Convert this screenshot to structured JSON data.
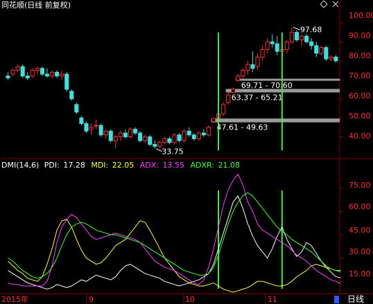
{
  "title": "同花顺(日线 前复权)",
  "top_right_icons": [
    "diamond-icon",
    "close-icon"
  ],
  "price_axis": {
    "ticks": [
      "100.00",
      "90.00",
      "80.00",
      "70.00",
      "60.00",
      "50.00",
      "40.00"
    ]
  },
  "dmi_header": {
    "name": "DMI(14,6)",
    "items": [
      {
        "label": "PDI:",
        "value": "17.28",
        "color": "#ffffff"
      },
      {
        "label": "MDI:",
        "value": "22.05",
        "color": "#ffff44"
      },
      {
        "label": "ADX:",
        "value": "13.55",
        "color": "#ff44ff"
      },
      {
        "label": "ADXR:",
        "value": "21.08",
        "color": "#44ff44"
      }
    ]
  },
  "dmi_axis": {
    "ticks": [
      "75.00",
      "60.00",
      "45.00",
      "30.00",
      "15.00"
    ]
  },
  "x_axis": {
    "labels": [
      "2015年",
      "9",
      "10",
      "11"
    ],
    "right_label": "日线"
  },
  "annotations": {
    "high": "97.68",
    "low": "33.75",
    "ranges": [
      "69.71 - 70.60",
      "63.37 - 65.21",
      "47.61 - 49.63"
    ]
  },
  "colors": {
    "up": "#ff3333",
    "down": "#44dddd",
    "grid_red": "#8a0000",
    "pdi": "#ffffff",
    "mdi": "#ffff44",
    "adx": "#ff44ff",
    "adxr": "#44ff44",
    "marker": "#44ee44",
    "gap_band": "#9a9a9a",
    "axis_text": "#ff3333"
  },
  "chart_data": [
    {
      "type": "candlestick",
      "title": "同花顺(日线 前复权)",
      "ylim": [
        30,
        104
      ],
      "candles": [
        {
          "o": 72,
          "h": 74,
          "l": 70,
          "c": 71
        },
        {
          "o": 73,
          "h": 76,
          "l": 72,
          "c": 75
        },
        {
          "o": 75,
          "h": 78,
          "l": 74,
          "c": 77
        },
        {
          "o": 77,
          "h": 78,
          "l": 71,
          "c": 72
        },
        {
          "o": 72,
          "h": 74,
          "l": 70,
          "c": 71
        },
        {
          "o": 72,
          "h": 76,
          "l": 71,
          "c": 75
        },
        {
          "o": 75,
          "h": 77,
          "l": 73,
          "c": 76
        },
        {
          "o": 76,
          "h": 77,
          "l": 72,
          "c": 73
        },
        {
          "o": 73,
          "h": 76,
          "l": 71,
          "c": 72
        },
        {
          "o": 72,
          "h": 75,
          "l": 71,
          "c": 74
        },
        {
          "o": 74,
          "h": 75,
          "l": 71,
          "c": 72
        },
        {
          "o": 72,
          "h": 75,
          "l": 70,
          "c": 73
        },
        {
          "o": 73,
          "h": 74,
          "l": 64,
          "c": 65
        },
        {
          "o": 64,
          "h": 65,
          "l": 59,
          "c": 60
        },
        {
          "o": 57,
          "h": 58,
          "l": 52,
          "c": 53
        },
        {
          "o": 50,
          "h": 51,
          "l": 46,
          "c": 47
        },
        {
          "o": 47,
          "h": 48,
          "l": 42,
          "c": 43
        },
        {
          "o": 44,
          "h": 47,
          "l": 41,
          "c": 45
        },
        {
          "o": 46,
          "h": 49,
          "l": 44,
          "c": 46
        },
        {
          "o": 46,
          "h": 47,
          "l": 40,
          "c": 41
        },
        {
          "o": 41,
          "h": 44,
          "l": 39,
          "c": 43
        },
        {
          "o": 43,
          "h": 44,
          "l": 37,
          "c": 38
        },
        {
          "o": 38,
          "h": 41,
          "l": 34,
          "c": 40
        },
        {
          "o": 40,
          "h": 43,
          "l": 38,
          "c": 42
        },
        {
          "o": 42,
          "h": 44,
          "l": 39,
          "c": 40
        },
        {
          "o": 40,
          "h": 45,
          "l": 39,
          "c": 44
        },
        {
          "o": 44,
          "h": 45,
          "l": 41,
          "c": 42
        },
        {
          "o": 42,
          "h": 43,
          "l": 37,
          "c": 38
        },
        {
          "o": 38,
          "h": 41,
          "l": 37,
          "c": 40
        },
        {
          "o": 40,
          "h": 41,
          "l": 35,
          "c": 36
        },
        {
          "o": 36,
          "h": 38,
          "l": 33.75,
          "c": 35
        },
        {
          "o": 35,
          "h": 38,
          "l": 34,
          "c": 37
        },
        {
          "o": 37,
          "h": 40,
          "l": 36,
          "c": 39
        },
        {
          "o": 39,
          "h": 40,
          "l": 36,
          "c": 37
        },
        {
          "o": 37,
          "h": 42,
          "l": 36,
          "c": 41
        },
        {
          "o": 41,
          "h": 42,
          "l": 37,
          "c": 38
        },
        {
          "o": 38,
          "h": 44,
          "l": 37,
          "c": 43
        },
        {
          "o": 43,
          "h": 45,
          "l": 40,
          "c": 41
        },
        {
          "o": 41,
          "h": 42,
          "l": 38,
          "c": 39
        },
        {
          "o": 39,
          "h": 43,
          "l": 38,
          "c": 42
        },
        {
          "o": 42,
          "h": 44,
          "l": 40,
          "c": 41
        },
        {
          "o": 41,
          "h": 46,
          "l": 40,
          "c": 45
        },
        {
          "o": 48,
          "h": 50,
          "l": 47.61,
          "c": 49.63
        },
        {
          "o": 50,
          "h": 53,
          "l": 49,
          "c": 52
        },
        {
          "o": 52,
          "h": 58,
          "l": 51,
          "c": 57
        },
        {
          "o": 58,
          "h": 63.37,
          "l": 57,
          "c": 62
        },
        {
          "o": 63.37,
          "h": 66,
          "l": 63,
          "c": 65.21
        },
        {
          "o": 69.71,
          "h": 73,
          "l": 69,
          "c": 72
        },
        {
          "o": 72,
          "h": 76,
          "l": 70.6,
          "c": 75
        },
        {
          "o": 75,
          "h": 80,
          "l": 73,
          "c": 78
        },
        {
          "o": 78,
          "h": 85,
          "l": 74,
          "c": 76
        },
        {
          "o": 77,
          "h": 84,
          "l": 75,
          "c": 82
        },
        {
          "o": 82,
          "h": 88,
          "l": 80,
          "c": 86
        },
        {
          "o": 86,
          "h": 92,
          "l": 84,
          "c": 90
        },
        {
          "o": 90,
          "h": 94,
          "l": 87,
          "c": 89
        },
        {
          "o": 89,
          "h": 93,
          "l": 83,
          "c": 85
        },
        {
          "o": 85,
          "h": 88,
          "l": 82,
          "c": 86
        },
        {
          "o": 86,
          "h": 91,
          "l": 84,
          "c": 90
        },
        {
          "o": 90,
          "h": 97.68,
          "l": 89,
          "c": 95
        },
        {
          "o": 95,
          "h": 96,
          "l": 90,
          "c": 91
        },
        {
          "o": 91,
          "h": 94,
          "l": 88,
          "c": 93
        },
        {
          "o": 93,
          "h": 94,
          "l": 89,
          "c": 90
        },
        {
          "o": 90,
          "h": 92,
          "l": 86,
          "c": 88
        },
        {
          "o": 88,
          "h": 90,
          "l": 82,
          "c": 84
        },
        {
          "o": 84,
          "h": 88,
          "l": 83,
          "c": 87
        },
        {
          "o": 87,
          "h": 88,
          "l": 80,
          "c": 81
        },
        {
          "o": 81,
          "h": 83,
          "l": 80,
          "c": 82
        },
        {
          "o": 82,
          "h": 83,
          "l": 79,
          "c": 80
        }
      ],
      "gap_bands": [
        [
          69.71,
          70.6
        ],
        [
          63.37,
          65.21
        ],
        [
          47.61,
          49.63
        ]
      ],
      "markers": [
        43,
        56
      ]
    },
    {
      "type": "line",
      "title": "DMI(14,6)",
      "ylim": [
        8,
        86
      ],
      "series": [
        {
          "name": "PDI",
          "values": [
            22,
            20,
            18,
            16,
            14,
            13,
            12,
            11,
            10,
            11,
            13,
            12,
            11,
            12,
            14,
            16,
            15,
            17,
            19,
            18,
            17,
            16,
            18,
            22,
            25,
            26,
            24,
            22,
            20,
            19,
            18,
            17,
            15,
            14,
            13,
            12,
            13,
            14,
            15,
            16,
            18,
            20,
            26,
            36,
            46,
            56,
            66,
            70,
            62,
            52,
            44,
            38,
            34,
            30,
            36,
            44,
            50,
            42,
            36,
            31,
            34,
            40,
            38,
            33,
            28,
            24,
            21,
            18,
            17.28
          ]
        },
        {
          "name": "MDI",
          "values": [
            28,
            25,
            22,
            20,
            17,
            16,
            15,
            18,
            26,
            36,
            48,
            54,
            55,
            50,
            42,
            35,
            30,
            28,
            26,
            27,
            30,
            34,
            38,
            40,
            42,
            46,
            50,
            54,
            53,
            48,
            42,
            36,
            30,
            26,
            22,
            18,
            16,
            14,
            13,
            12,
            12,
            13,
            14,
            12,
            10,
            9,
            8,
            9,
            10,
            11,
            13,
            15,
            15,
            14,
            13,
            12,
            12,
            13,
            15,
            18,
            20,
            22,
            25,
            26,
            25,
            24,
            23,
            22,
            22.05
          ]
        },
        {
          "name": "ADX",
          "values": [
            14,
            13,
            13,
            12,
            12,
            12,
            12,
            12,
            15,
            25,
            40,
            50,
            55,
            58,
            56,
            52,
            48,
            44,
            42,
            43,
            44,
            45,
            46,
            45,
            44,
            43,
            42,
            40,
            36,
            32,
            28,
            26,
            24,
            23,
            22,
            20,
            18,
            16,
            14,
            13,
            16,
            24,
            36,
            50,
            64,
            74,
            80,
            84,
            77,
            66,
            60,
            52,
            48,
            46,
            44,
            42,
            40,
            38,
            35,
            32,
            30,
            28,
            25,
            22,
            20,
            18,
            16,
            15,
            13.55
          ]
        },
        {
          "name": "ADXR",
          "values": [
            30,
            28,
            25,
            22,
            20,
            18,
            17,
            18,
            20,
            24,
            30,
            38,
            45,
            50,
            52,
            53,
            52,
            50,
            48,
            47,
            46,
            45,
            45,
            44,
            43,
            42,
            41,
            40,
            38,
            36,
            34,
            32,
            30,
            28,
            26,
            24,
            22,
            21,
            20,
            19,
            19,
            20,
            24,
            32,
            42,
            52,
            60,
            66,
            70,
            72,
            70,
            66,
            62,
            58,
            54,
            50,
            47,
            45,
            42,
            40,
            38,
            36,
            34,
            31,
            28,
            25,
            23,
            22,
            21.08
          ]
        }
      ],
      "markers": [
        43,
        56
      ]
    }
  ]
}
